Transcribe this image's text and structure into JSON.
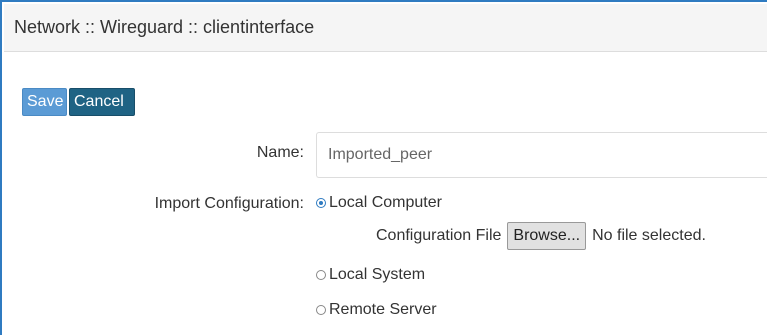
{
  "header": {
    "title": "Network :: Wireguard :: clientinterface"
  },
  "toolbar": {
    "save_label": "Save",
    "cancel_label": "Cancel"
  },
  "form": {
    "name_label": "Name:",
    "name_value": "Imported_peer",
    "import_label": "Import Configuration:",
    "options": [
      {
        "label": "Local Computer",
        "selected": true
      },
      {
        "label": "Local System",
        "selected": false
      },
      {
        "label": "Remote Server",
        "selected": false
      }
    ],
    "config_file_label": "Configuration File",
    "browse_label": "Browse...",
    "file_status": "No file selected."
  },
  "colors": {
    "accent": "#2f7bc1",
    "save": "#5b9bd5",
    "cancel": "#1f6384"
  }
}
